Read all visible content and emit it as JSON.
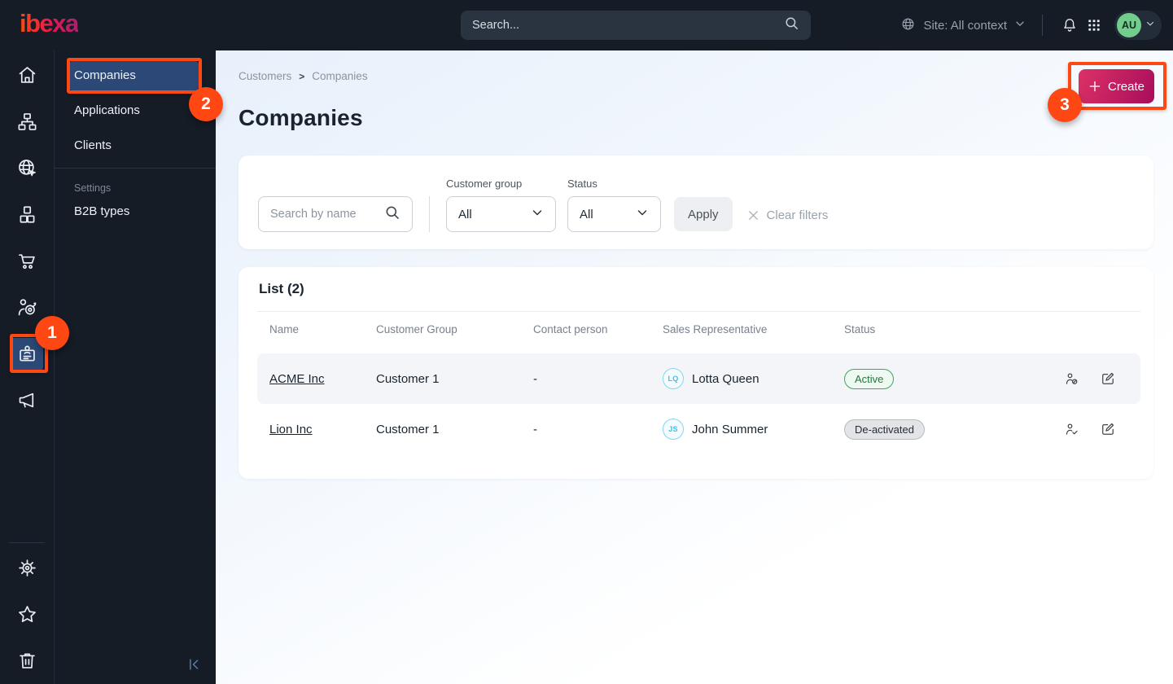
{
  "topbar": {
    "logo_text": "ibexa",
    "search_placeholder": "Search...",
    "site_context_label": "Site: All context",
    "avatar_initials": "AU"
  },
  "sidebar": {
    "icons": [
      "home-icon",
      "sitemap-icon",
      "site-globe-icon",
      "product-catalog-icon",
      "commerce-cart-icon",
      "personalization-icon",
      "customers-badge-icon",
      "marketing-megaphone-icon"
    ],
    "selected_icon": "customers-badge-icon",
    "bottom_icons": [
      "settings-gear-icon",
      "bookmarks-star-icon",
      "trash-icon"
    ]
  },
  "menu": {
    "items": [
      {
        "label": "Companies",
        "selected": true
      },
      {
        "label": "Applications",
        "selected": false
      },
      {
        "label": "Clients",
        "selected": false
      }
    ],
    "section_label": "Settings",
    "section_items": [
      {
        "label": "B2B types"
      }
    ]
  },
  "breadcrumb": {
    "items": [
      "Customers",
      "Companies"
    ],
    "separator": ">"
  },
  "page": {
    "title": "Companies",
    "create_button": "Create"
  },
  "filters": {
    "search_placeholder": "Search by name",
    "customer_group": {
      "label": "Customer group",
      "value": "All"
    },
    "status": {
      "label": "Status",
      "value": "All"
    },
    "apply_button": "Apply",
    "clear_button": "Clear filters"
  },
  "list": {
    "heading": "List (2)",
    "columns": [
      "Name",
      "Customer Group",
      "Contact person",
      "Sales Representative",
      "Status"
    ],
    "rows": [
      {
        "name": "ACME Inc",
        "customer_group": "Customer 1",
        "contact_person": "-",
        "sales_rep_initials": "LQ",
        "sales_rep": "Lotta Queen",
        "status": "Active"
      },
      {
        "name": "Lion Inc",
        "customer_group": "Customer 1",
        "contact_person": "-",
        "sales_rep_initials": "JS",
        "sales_rep": "John Summer",
        "status": "De-activated"
      }
    ]
  },
  "annotations": {
    "step1": "1",
    "step2": "2",
    "step3": "3"
  },
  "colors": {
    "topbar_dark": "#151c26",
    "selected_blue": "#2c4876",
    "annotation_orange": "#ff4713",
    "create_gradient_start": "#dc3166",
    "create_gradient_end": "#a80d5c",
    "active_green": "#41a45f",
    "avatar_green": "#72cf8b",
    "rep_avatar_blue": "#3fc0e4"
  }
}
